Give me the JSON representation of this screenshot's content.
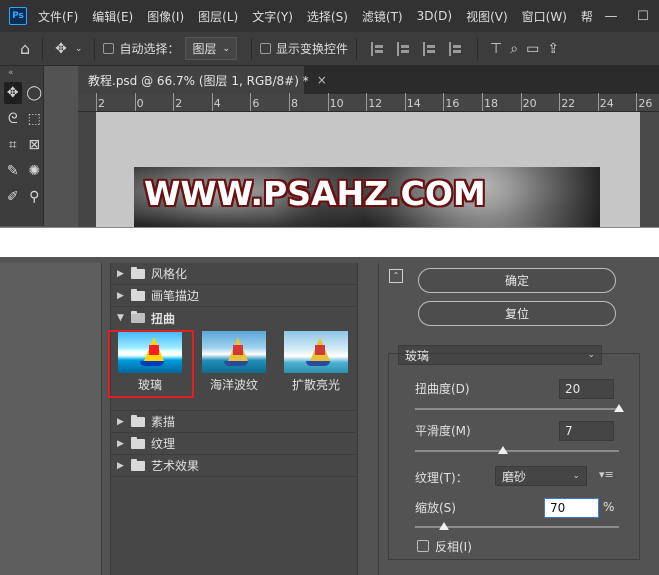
{
  "menubar": {
    "logo": "Ps",
    "items": [
      "文件(F)",
      "编辑(E)",
      "图像(I)",
      "图层(L)",
      "文字(Y)",
      "选择(S)",
      "滤镜(T)",
      "3D(D)",
      "视图(V)",
      "窗口(W)",
      "帮"
    ],
    "minimize": "—",
    "maximize": "☐"
  },
  "options": {
    "auto_select_label": "自动选择：",
    "auto_select_value": "图层",
    "show_transform_label": "显示变换控件"
  },
  "document": {
    "tab_title": "教程.psd @ 66.7% (图层 1, RGB/8#) *",
    "close": "×",
    "ruler_labels": [
      "2",
      "0",
      "2",
      "4",
      "6",
      "8",
      "10",
      "12",
      "14",
      "16",
      "18",
      "20",
      "22",
      "24",
      "26"
    ],
    "watermark": "WWW.PSAHZ.COM"
  },
  "gallery": {
    "categories_before": [
      {
        "label": "风格化",
        "arrow": "▶"
      },
      {
        "label": "画笔描边",
        "arrow": "▶"
      }
    ],
    "open_category": {
      "label": "扭曲",
      "arrow": "▼"
    },
    "thumbnails": [
      {
        "label": "玻璃",
        "selected": true
      },
      {
        "label": "海洋波纹",
        "selected": false
      },
      {
        "label": "扩散亮光",
        "selected": false
      }
    ],
    "categories_after": [
      {
        "label": "素描",
        "arrow": "▶"
      },
      {
        "label": "纹理",
        "arrow": "▶"
      },
      {
        "label": "艺术效果",
        "arrow": "▶"
      }
    ]
  },
  "panel": {
    "collapse": "⌃",
    "ok_label": "确定",
    "reset_label": "复位",
    "filter_select": "玻璃",
    "distortion_label": "扭曲度(D)",
    "distortion_value": "20",
    "distortion_level": 1.0,
    "smoothness_label": "平滑度(M)",
    "smoothness_value": "7",
    "smoothness_level": 0.43,
    "texture_label": "纹理(T)：",
    "texture_value": "磨砂",
    "scale_label": "缩放(S)",
    "scale_value": "70",
    "scale_unit": "%",
    "scale_level": 0.14,
    "invert_label": "反相(I)",
    "menu_icon": "▾≡"
  }
}
